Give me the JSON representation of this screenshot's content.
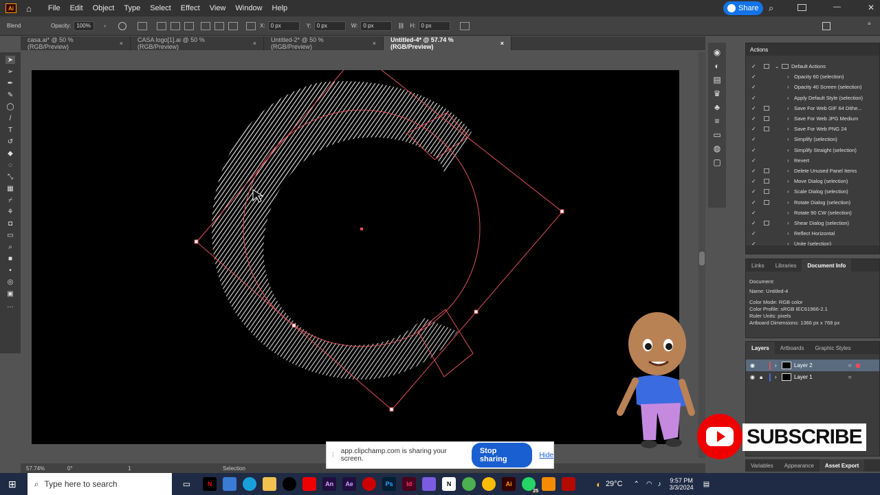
{
  "menubar": {
    "app_logo": "Ai",
    "items": [
      "File",
      "Edit",
      "Object",
      "Type",
      "Select",
      "Effect",
      "View",
      "Window",
      "Help"
    ],
    "share": "Share"
  },
  "controlbar": {
    "mode": "Blend",
    "opacity_label": "Opacity:",
    "opacity_value": "100%",
    "x_label": "X:",
    "x_value": "0 px",
    "y_label": "Y:",
    "y_value": "0 px",
    "w_label": "W:",
    "w_value": "0 px",
    "h_label": "H:",
    "h_value": "0 px"
  },
  "tabs": [
    {
      "label": "casa.ai* @ 50 % (RGB/Preview)"
    },
    {
      "label": "CASA logo[1].ai @ 50 % (RGB/Preview)"
    },
    {
      "label": "Untitled-2* @ 50 % (RGB/Preview)"
    },
    {
      "label": "Untitled-4* @ 57.74 % (RGB/Preview)"
    }
  ],
  "tab_close": "×",
  "actions_panel": {
    "title": "Actions",
    "folder": "Default Actions",
    "items": [
      {
        "label": "Opacity 60 (selection)",
        "sq": false
      },
      {
        "label": "Opacity 40 Screen (selection)",
        "sq": false
      },
      {
        "label": "Apply Default Style (selection)",
        "sq": false
      },
      {
        "label": "Save For Web GIF 64 Dithe...",
        "sq": true
      },
      {
        "label": "Save For Web JPG Medium",
        "sq": true
      },
      {
        "label": "Save For Web PNG 24",
        "sq": true
      },
      {
        "label": "Simplify (selection)",
        "sq": false
      },
      {
        "label": "Simplify Straight (selection)",
        "sq": false
      },
      {
        "label": "Revert",
        "sq": false
      },
      {
        "label": "Delete Unused Panel Items",
        "sq": true
      },
      {
        "label": "Move Dialog (selection)",
        "sq": true
      },
      {
        "label": "Scale Dialog (selection)",
        "sq": true
      },
      {
        "label": "Rotate Dialog (selection)",
        "sq": true
      },
      {
        "label": "Rotate 90 CW (selection)",
        "sq": false
      },
      {
        "label": "Shear Dialog (selection)",
        "sq": true
      },
      {
        "label": "Reflect Horizontal",
        "sq": false
      },
      {
        "label": "Unite (selection)",
        "sq": false
      }
    ]
  },
  "docinfo_panel": {
    "tabs": [
      "Links",
      "Libraries",
      "Document Info"
    ],
    "lines": [
      "Document:",
      "Name: Untitled-4",
      "Color Mode: RGB color",
      "Color Profile: sRGB IEC61966-2.1",
      "Ruler Units: pixels",
      "Artboard Dimensions: 1366 px x 768 px"
    ]
  },
  "layers_panel": {
    "tabs": [
      "Layers",
      "Artboards",
      "Graphic Styles"
    ],
    "layers": [
      {
        "name": "Layer 2"
      },
      {
        "name": "Layer 1"
      }
    ]
  },
  "bottom_tabs": [
    "Variables",
    "Appearance",
    "Asset Export"
  ],
  "statusbar": {
    "zoom": "57.74%",
    "rotation": "0°",
    "artboard": "1",
    "tool": "Selection"
  },
  "sharebar": {
    "text": "app.clipchamp.com is sharing your screen.",
    "stop": "Stop sharing",
    "hide": "Hide"
  },
  "taskbar": {
    "search_placeholder": "Type here to search",
    "weather": "29°C",
    "time": "9:57 PM",
    "date": "3/3/2024",
    "badge": "25",
    "apps": [
      "An",
      "Ae",
      "Ps",
      "Id",
      "Ai",
      "N"
    ]
  },
  "overlay": {
    "subscribe": "SUBSCRIBE"
  },
  "colors": {
    "selection": "#e0505a",
    "accent": "#1473e6",
    "artboard": "#000000"
  }
}
